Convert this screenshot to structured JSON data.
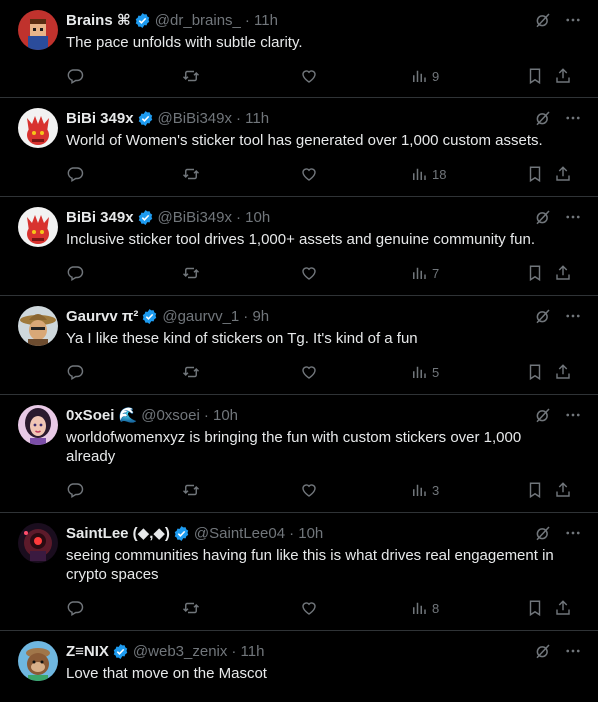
{
  "colors": {
    "background": "#000000",
    "text": "#e7e9ea",
    "muted": "#71767b",
    "verified": "#1d9bf0",
    "divider": "#2f3336"
  },
  "tweets": [
    {
      "name": "Brains ⌘",
      "handle": "@dr_brains_",
      "time": "· 11h",
      "text": "The pace unfolds with subtle clarity.",
      "views": "9",
      "avatar_icon": "pixel-avatar-icon"
    },
    {
      "name": "BiBi 349x",
      "handle": "@BiBi349x",
      "time": "· 11h",
      "text": "World of Women's sticker tool has generated over 1,000 custom assets.",
      "views": "18",
      "avatar_icon": "red-dragon-avatar-icon"
    },
    {
      "name": "BiBi 349x",
      "handle": "@BiBi349x",
      "time": "· 10h",
      "text": "Inclusive sticker tool drives 1,000+ assets and genuine community fun.",
      "views": "7",
      "avatar_icon": "red-dragon-avatar-icon"
    },
    {
      "name": "Gaurvv π²",
      "handle": "@gaurvv_1",
      "time": "· 9h",
      "text": "Ya I like these kind of stickers on Tg. It's kind of a fun",
      "views": "5",
      "avatar_icon": "straw-hat-avatar-icon"
    },
    {
      "name": "0xSoei 🌊",
      "handle": "@0xsoei",
      "time": "· 10h",
      "text": "worldofwomenxyz is bringing the fun with custom stickers over 1,000 already",
      "views": "3",
      "avatar_icon": "woman-avatar-icon"
    },
    {
      "name": "SaintLee (◆,◆)",
      "handle": "@SaintLee04",
      "time": "· 10h",
      "text": "seeing communities having fun like this is what drives real engagement in crypto spaces",
      "views": "8",
      "avatar_icon": "robot-avatar-icon"
    },
    {
      "name": "Z≡NIX",
      "handle": "@web3_zenix",
      "time": "· 11h",
      "text": "Love that move on the Mascot",
      "views": "",
      "avatar_icon": "monkey-avatar-icon"
    }
  ]
}
